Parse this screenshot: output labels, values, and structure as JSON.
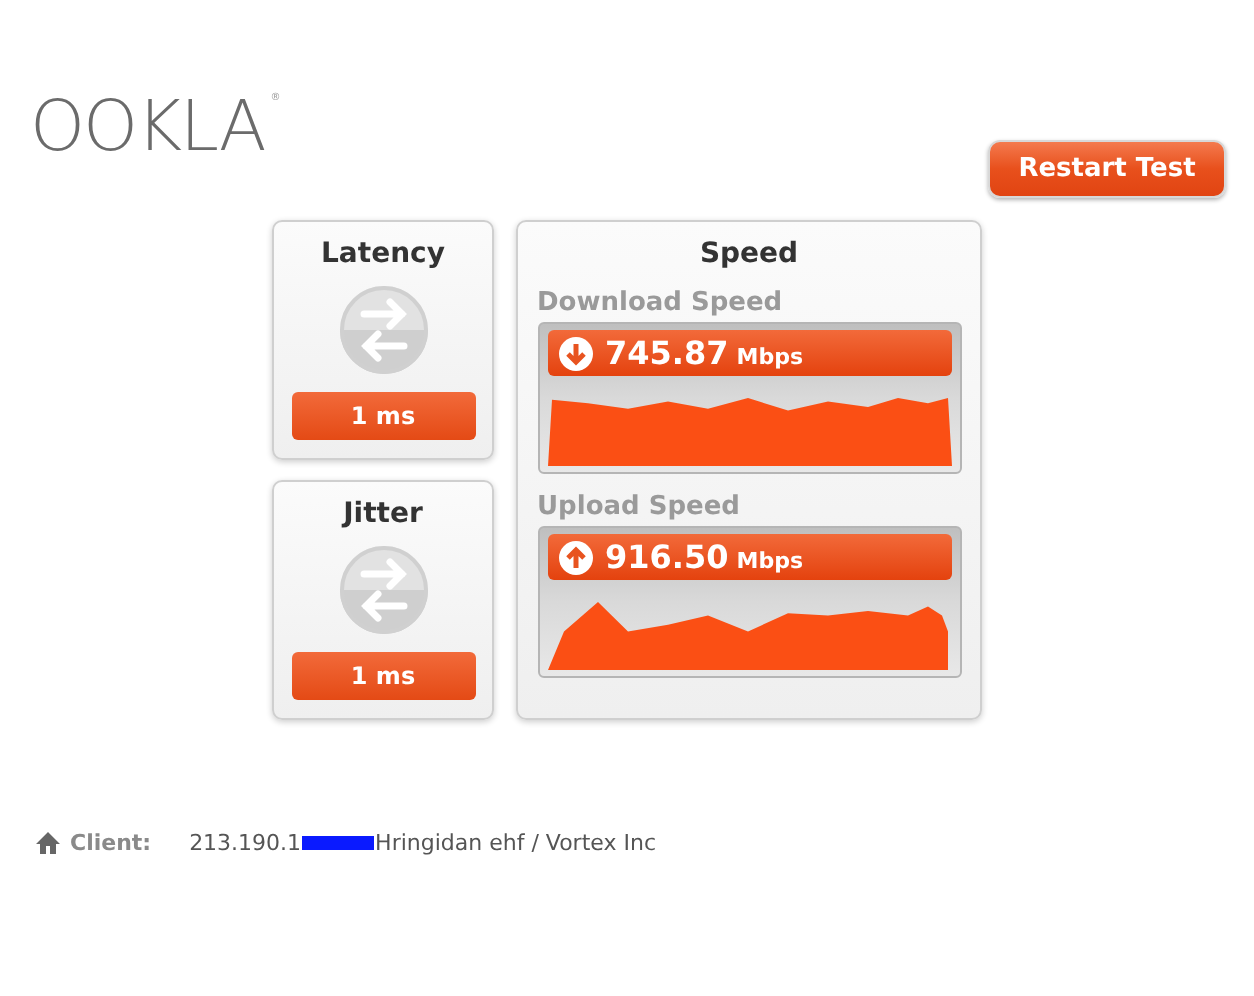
{
  "logo": {
    "text": "OOKLA",
    "mark": "®"
  },
  "restart_button": {
    "label": "Restart Test"
  },
  "metrics": [
    {
      "title": "Latency",
      "value": "1 ms"
    },
    {
      "title": "Jitter",
      "value": "1 ms"
    }
  ],
  "speed": {
    "title": "Speed",
    "tests": [
      {
        "kind": "download",
        "label": "Download Speed",
        "value": "745.87",
        "unit": "Mbps"
      },
      {
        "kind": "upload",
        "label": "Upload Speed",
        "value": "916.50",
        "unit": "Mbps"
      }
    ]
  },
  "client": {
    "label": "Client:",
    "ip": "213.190.1",
    "provider": "Hringidan ehf / Vortex Inc"
  }
}
